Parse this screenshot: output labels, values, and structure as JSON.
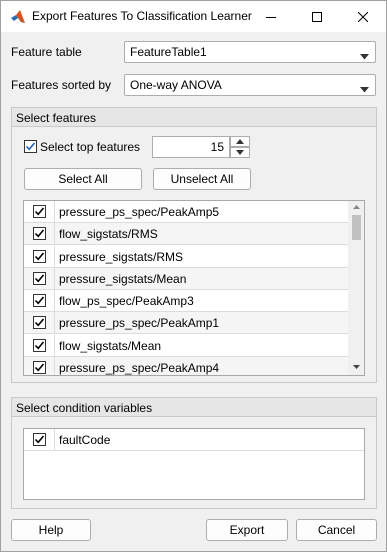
{
  "window": {
    "title": "Export Features To Classification Learner"
  },
  "form": {
    "feature_table_label": "Feature table",
    "feature_table_value": "FeatureTable1",
    "sorted_by_label": "Features sorted by",
    "sorted_by_value": "One-way ANOVA"
  },
  "select_features": {
    "panel_title": "Select features",
    "top_features_label": "Select top features",
    "top_features_checked": true,
    "top_features_count": "15",
    "select_all_label": "Select All",
    "unselect_all_label": "Unselect All",
    "rows": [
      {
        "label": "pressure_ps_spec/PeakAmp5",
        "checked": true
      },
      {
        "label": "flow_sigstats/RMS",
        "checked": true
      },
      {
        "label": "pressure_sigstats/RMS",
        "checked": true
      },
      {
        "label": "pressure_sigstats/Mean",
        "checked": true
      },
      {
        "label": "flow_ps_spec/PeakAmp3",
        "checked": true
      },
      {
        "label": "pressure_ps_spec/PeakAmp1",
        "checked": true
      },
      {
        "label": "flow_sigstats/Mean",
        "checked": true
      },
      {
        "label": "pressure_ps_spec/PeakAmp4",
        "checked": true
      }
    ]
  },
  "condition_variables": {
    "panel_title": "Select condition variables",
    "rows": [
      {
        "label": "faultCode",
        "checked": true
      }
    ]
  },
  "footer": {
    "help_label": "Help",
    "export_label": "Export",
    "cancel_label": "Cancel"
  },
  "colors": {
    "accent_check": "#000000",
    "panel_header": "#e6e6e6",
    "window_bg": "#f0f0f0"
  }
}
